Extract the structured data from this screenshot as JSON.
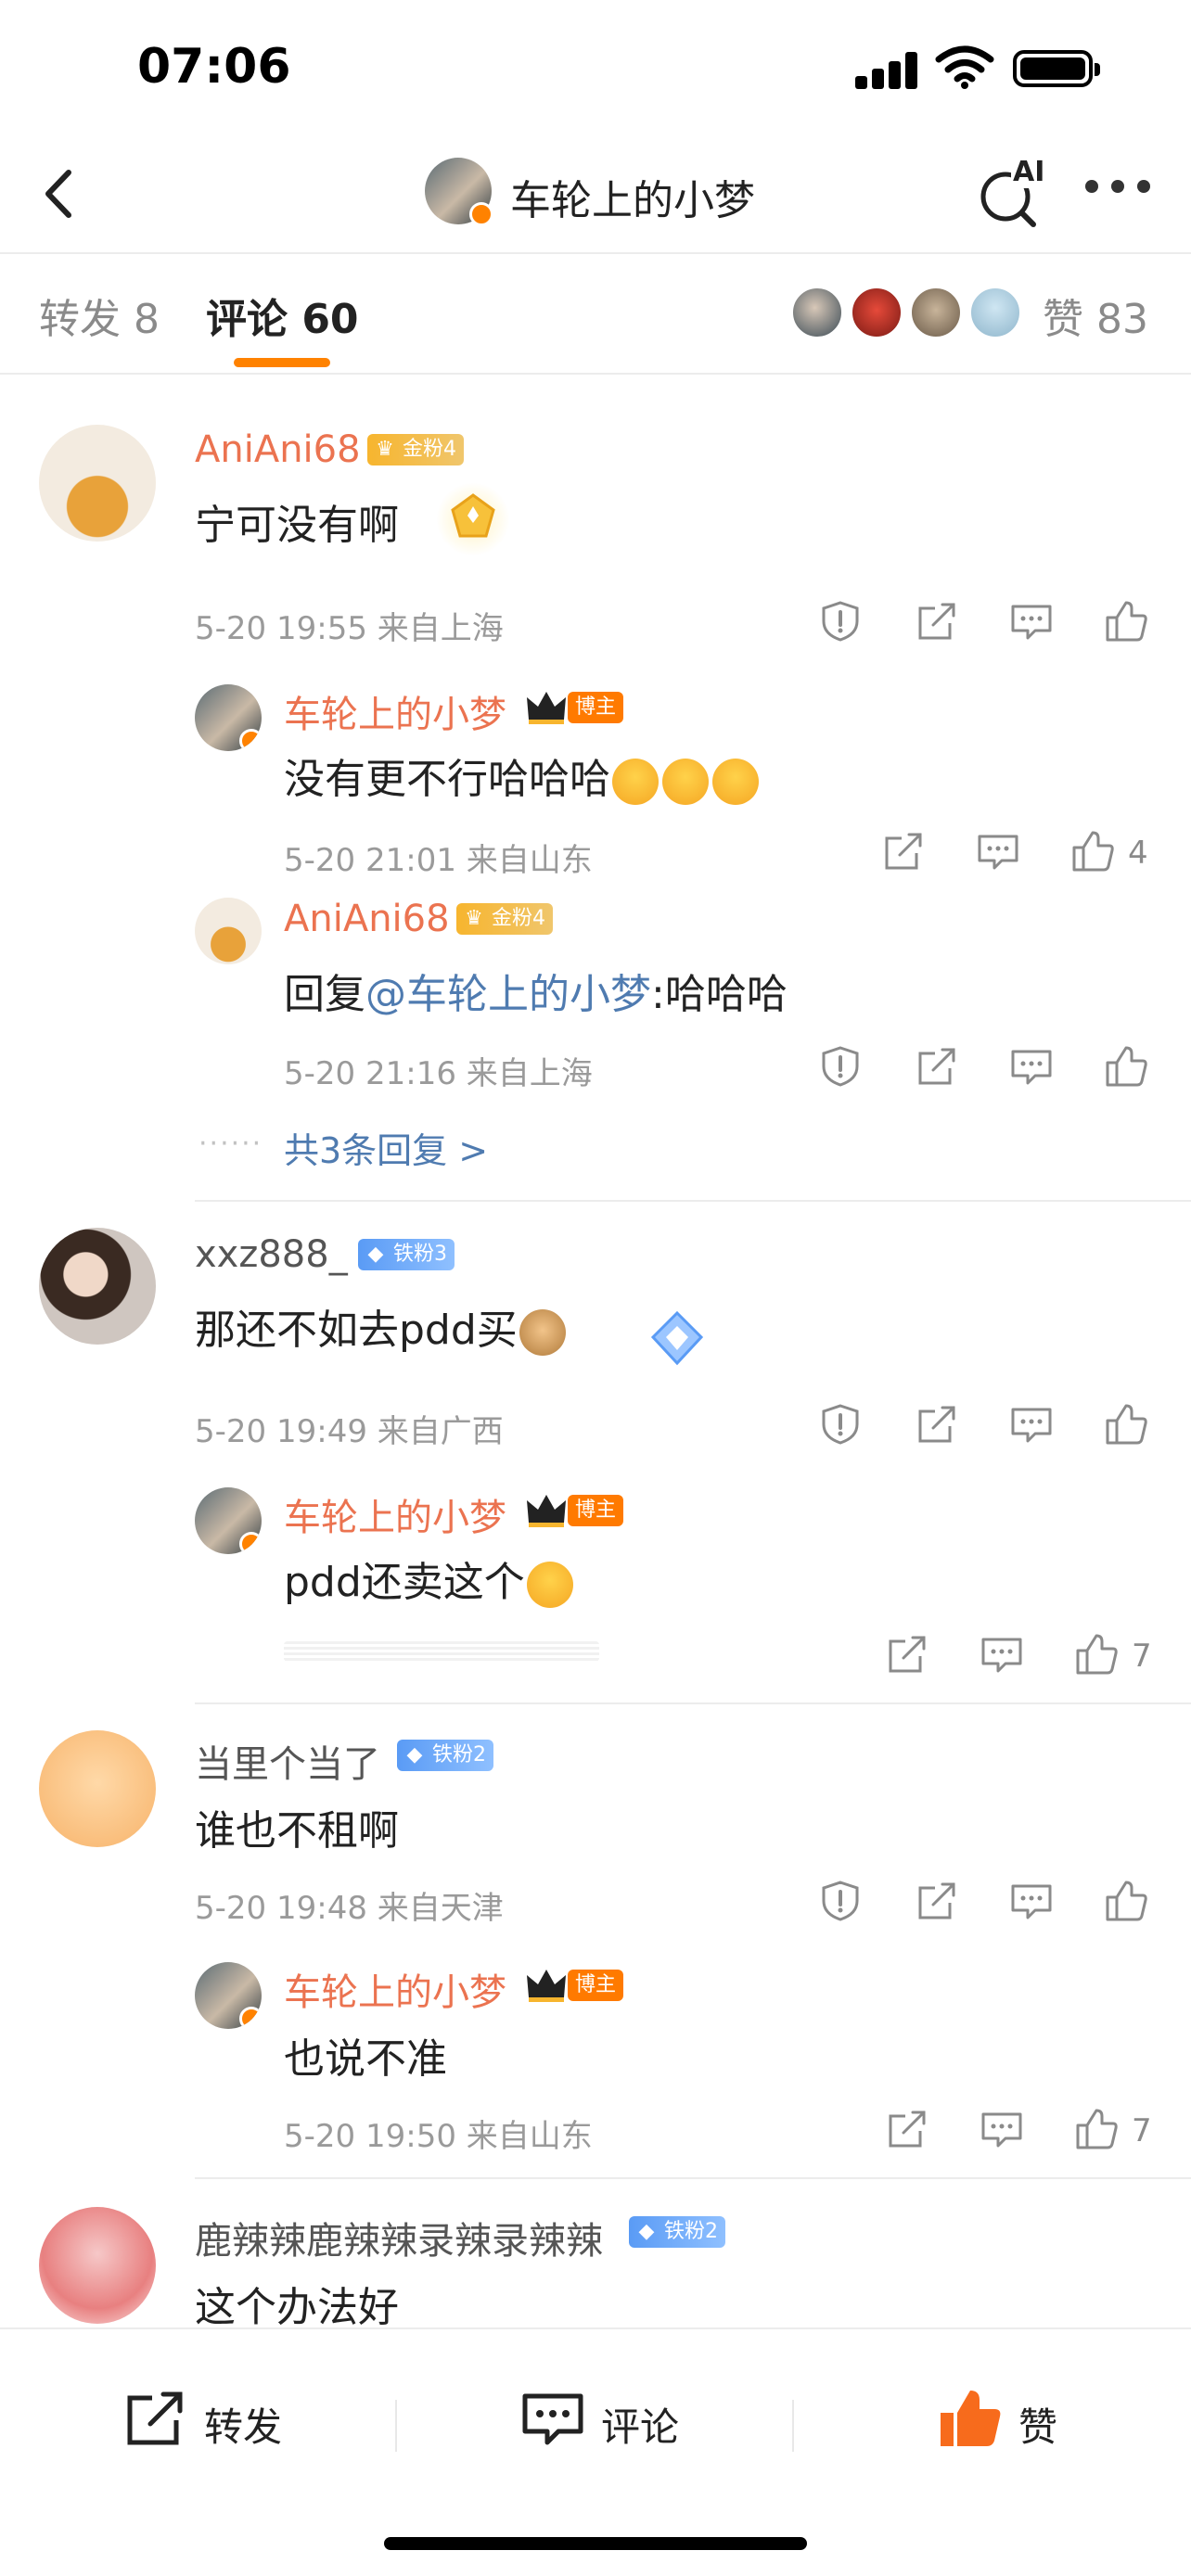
{
  "status_bar": {
    "time": "07:06"
  },
  "nav": {
    "title": "车轮上的小梦",
    "ai_label": "AI"
  },
  "tabs": {
    "repost": "转发 8",
    "comments": "评论 60",
    "likes": "赞 83"
  },
  "comments": [
    {
      "user": "AniAni68",
      "badge": "金粉4",
      "text": "宁可没有啊",
      "meta": "5-20 19:55 来自上海",
      "replies": [
        {
          "user": "车轮上的小梦",
          "badge": "博主",
          "text": "没有更不行哈哈哈",
          "meta": "5-20 21:01 来自山东",
          "like_count": "4"
        },
        {
          "user": "AniAni68",
          "badge": "金粉4",
          "text_prefix": "回复",
          "mention": "@车轮上的小梦",
          "text_suffix": ":哈哈哈",
          "meta": "5-20 21:16 来自上海"
        }
      ],
      "more_replies": "共3条回复 >"
    },
    {
      "user": "xxz888_",
      "badge": "铁粉3",
      "text": "那还不如去pdd买",
      "meta": "5-20 19:49 来自广西",
      "replies": [
        {
          "user": "车轮上的小梦",
          "badge": "博主",
          "text": "pdd还卖这个",
          "like_count": "7"
        }
      ]
    },
    {
      "user": "当里个当了",
      "badge": "铁粉2",
      "text": "谁也不租啊",
      "meta": "5-20 19:48 来自天津",
      "replies": [
        {
          "user": "车轮上的小梦",
          "badge": "博主",
          "text": "也说不准",
          "meta": "5-20 19:50 来自山东",
          "like_count": "7"
        }
      ]
    },
    {
      "user": "鹿辣辣鹿辣辣录辣录辣辣",
      "badge": "铁粉2",
      "text": "这个办法好"
    }
  ],
  "bottom_bar": {
    "repost": "转发",
    "comment": "评论",
    "like": "赞"
  },
  "colors": {
    "accent": "#ff8200",
    "username": "#eb7350",
    "link": "#4f7bb0",
    "like_active": "#f76b1c"
  },
  "icons": [
    "back-icon",
    "ai-search-icon",
    "more-icon",
    "report-icon",
    "share-icon",
    "comment-icon",
    "thumb-up-icon"
  ]
}
